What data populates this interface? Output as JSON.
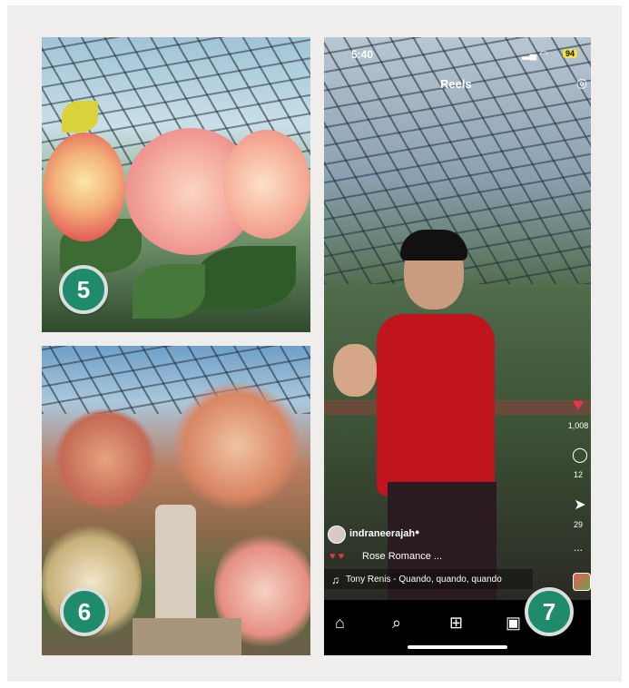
{
  "badges": {
    "photo5": "5",
    "photo6": "6",
    "photo7": "7"
  },
  "reel": {
    "status_time": "5:40",
    "battery": "94",
    "header_title": "Reels",
    "username": "indraneerajah",
    "caption": "Rose Romance ...",
    "audio": "Tony Renis - Quando, quando, quando",
    "likes_count": "1,008",
    "comments_count": "12",
    "shares_count": "29",
    "more": "..."
  },
  "icons": {
    "camera": "camera-icon",
    "like": "heart-icon",
    "comment": "comment-icon",
    "share": "send-icon",
    "more": "more-icon",
    "audio": "music-note-icon",
    "verified": "verified-icon",
    "home": "home-icon",
    "search": "search-icon",
    "create": "plus-square-icon",
    "reels": "reels-icon"
  },
  "colors": {
    "panel": "#efeeed",
    "badge": "#1f8a6c",
    "like": "#e8344a"
  }
}
